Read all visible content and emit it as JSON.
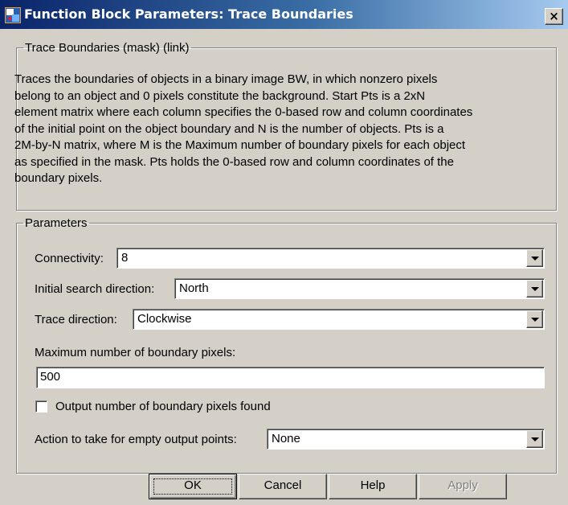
{
  "window": {
    "title": "Function Block Parameters: Trace Boundaries",
    "close_glyph": "×"
  },
  "mask": {
    "title": "Trace Boundaries (mask) (link)",
    "description_lines": [
      "Traces the boundaries of objects in a binary image BW, in which nonzero pixels",
      "belong to an object and  0 pixels constitute the background. Start Pts is a 2xN",
      "element matrix where each column specifies the 0-based row and column coordinates",
      "of the initial point on the object boundary and N is the number of objects. Pts is a",
      "2M-by-N matrix, where M is the Maximum number of boundary pixels for each object",
      "as specified in the mask. Pts holds the 0-based row and column coordinates of the",
      "boundary pixels."
    ]
  },
  "parameters": {
    "title": "Parameters",
    "connectivity": {
      "label": "Connectivity:",
      "value": "8"
    },
    "initial_search_direction": {
      "label": "Initial search direction:",
      "value": "North"
    },
    "trace_direction": {
      "label": "Trace direction:",
      "value": "Clockwise"
    },
    "max_boundary_pixels": {
      "label": "Maximum number of boundary pixels:",
      "value": "500"
    },
    "output_count": {
      "label": "Output number of boundary pixels found",
      "checked": false
    },
    "empty_action": {
      "label": "Action to take for empty output points:",
      "value": "None"
    }
  },
  "buttons": {
    "ok": "OK",
    "cancel": "Cancel",
    "help": "Help",
    "apply": "Apply"
  },
  "icons": {
    "app": "simulink-block-icon",
    "dropdown": "chevron-down-icon"
  }
}
